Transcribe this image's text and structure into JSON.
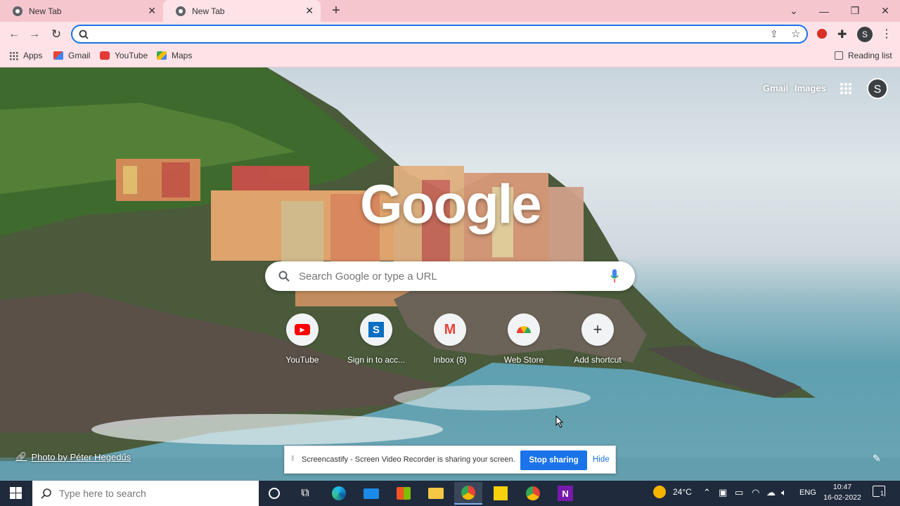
{
  "browser": {
    "tabs": [
      {
        "title": "New Tab"
      },
      {
        "title": "New Tab"
      }
    ],
    "omnibox_value": "",
    "profile_initial": "S",
    "bookmarks": [
      {
        "label": "Apps",
        "icon": "apps-grid-icon"
      },
      {
        "label": "Gmail",
        "icon": "gmail-icon"
      },
      {
        "label": "YouTube",
        "icon": "youtube-icon"
      },
      {
        "label": "Maps",
        "icon": "maps-icon"
      }
    ],
    "reading_list": "Reading list"
  },
  "ntp": {
    "top_links": {
      "gmail": "Gmail",
      "images": "Images"
    },
    "avatar_initial": "S",
    "logo_text": "Google",
    "search_placeholder": "Search Google or type a URL",
    "shortcuts": [
      {
        "label": "YouTube",
        "icon": "youtube-icon"
      },
      {
        "label": "Sign in to acc...",
        "icon": "s-app-icon"
      },
      {
        "label": "Inbox (8)",
        "icon": "gmail-icon"
      },
      {
        "label": "Web Store",
        "icon": "web-store-icon"
      },
      {
        "label": "Add shortcut",
        "icon": "plus-icon"
      }
    ],
    "photo_credit": "Photo by Péter Hegedűs"
  },
  "share_banner": {
    "message": "Screencastify - Screen Video Recorder is sharing your screen.",
    "stop_label": "Stop sharing",
    "hide_label": "Hide"
  },
  "taskbar": {
    "search_placeholder": "Type here to search",
    "weather": "24°C",
    "language": "ENG",
    "time": "10:47",
    "date": "16-02-2022",
    "notification_count": "1"
  },
  "colors": {
    "accent": "#1a73e8",
    "tab_strip": "#f6c6cf",
    "toolbar": "#fde3e8",
    "taskbar": "#1f2a3c"
  }
}
